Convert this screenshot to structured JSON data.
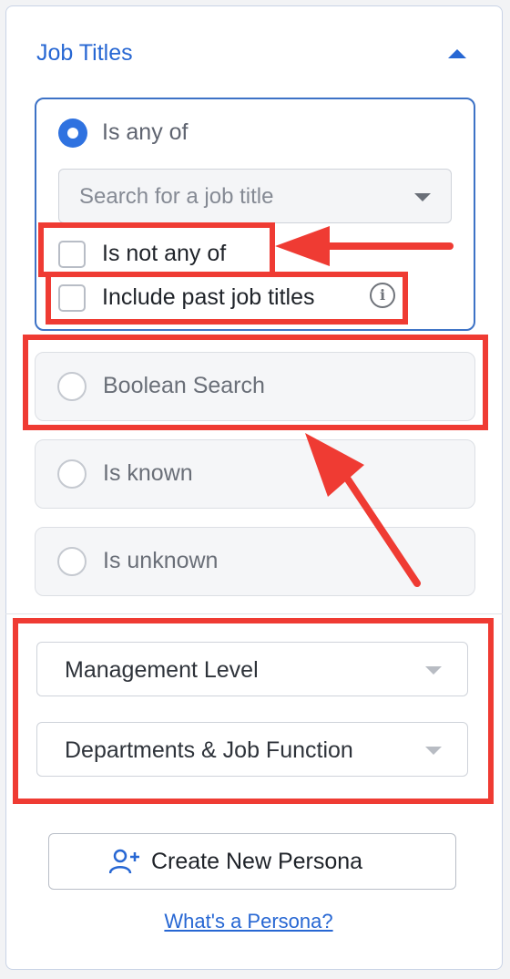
{
  "section": {
    "title": "Job Titles",
    "collapse_icon": "chevron-up-icon"
  },
  "options": {
    "is_any_of": "Is any of",
    "search_placeholder": "Search for a job title",
    "is_not_any_of": "Is not any of",
    "include_past": "Include past job titles",
    "boolean_search": "Boolean Search",
    "is_known": "Is known",
    "is_unknown": "Is unknown"
  },
  "filters": {
    "management_level": "Management Level",
    "departments": "Departments & Job Function"
  },
  "actions": {
    "create_persona": "Create New Persona",
    "persona_link": "What's a Persona?"
  },
  "colors": {
    "accent": "#2767d3",
    "radio_selected": "#2f72e0",
    "annotation": "#ef3b33"
  }
}
